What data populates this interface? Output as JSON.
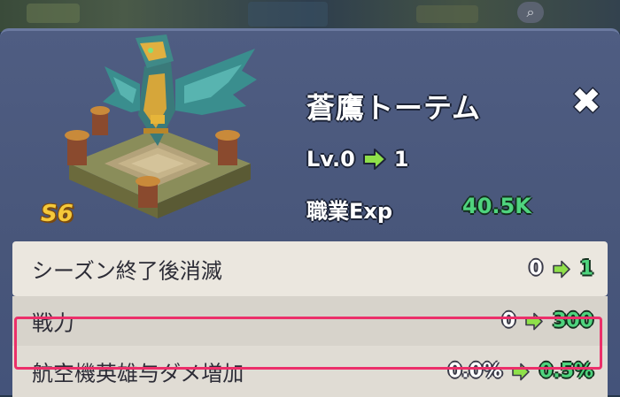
{
  "background": {
    "map_icon": "map-toggle-icon"
  },
  "building": {
    "name": "蒼鷹トーテム",
    "season_badge": "S6",
    "level_current": "Lv.0",
    "level_next": "1",
    "exp_label": "職業Exp",
    "exp_value": "40.5K"
  },
  "close_icon": "close-icon",
  "stats": [
    {
      "label": "シーズン終了後消滅",
      "current": "0",
      "next": "1"
    },
    {
      "label": "戦力",
      "current": "0",
      "next": "300"
    },
    {
      "label": "航空機英雄与ダメ増加",
      "current": "0.0%",
      "next": "0.5%"
    }
  ],
  "colors": {
    "panel": "#4f5d82",
    "value_green": "#4fd47e",
    "highlight": "#ec2f6a",
    "season_badge": "#f5c93a"
  }
}
